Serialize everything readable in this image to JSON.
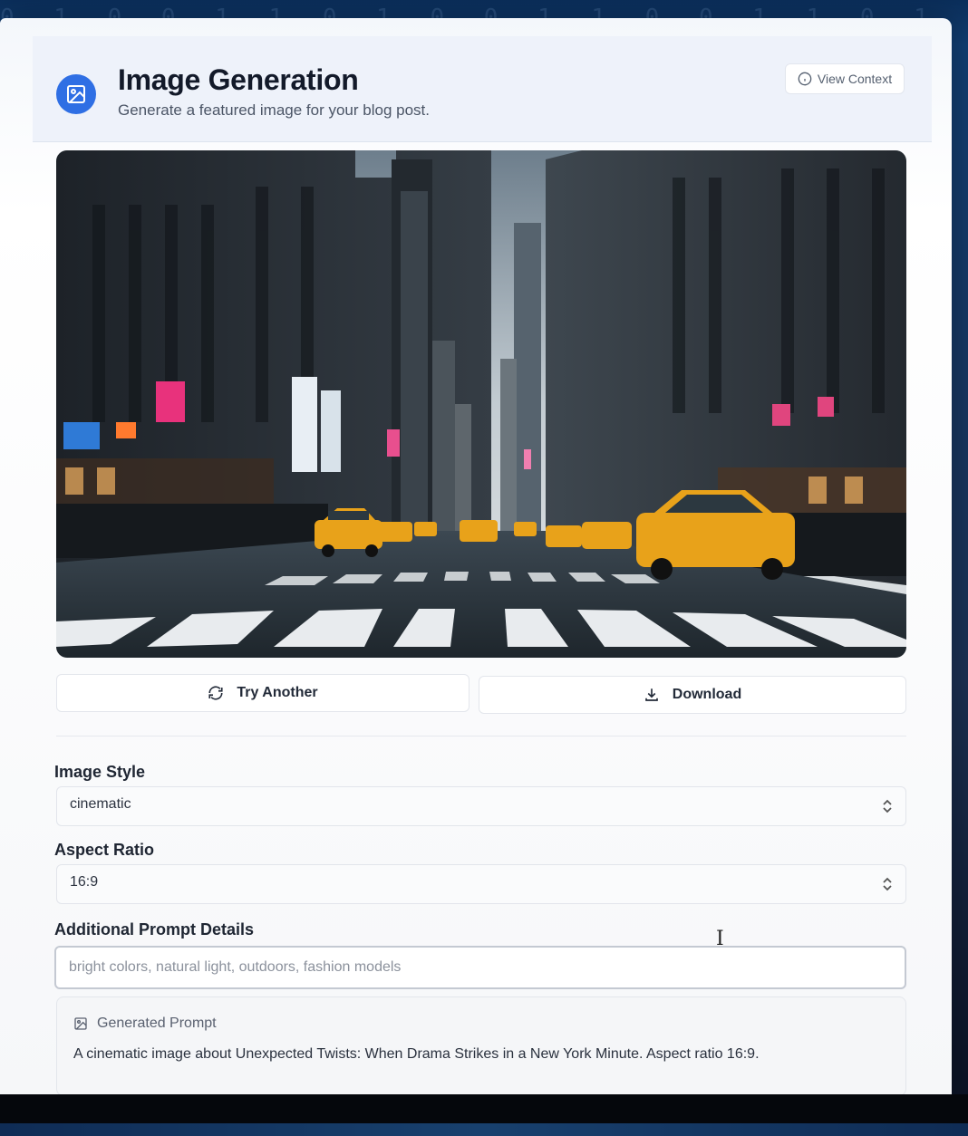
{
  "header": {
    "title": "Image Generation",
    "subtitle": "Generate a featured image for your blog post.",
    "view_context_label": "View Context",
    "app_icon": "image-icon",
    "view_context_icon": "info-icon"
  },
  "actions": {
    "try_another_label": "Try Another",
    "try_another_icon": "refresh-icon",
    "download_label": "Download",
    "download_icon": "download-icon"
  },
  "form": {
    "image_style": {
      "label": "Image Style",
      "value": "cinematic"
    },
    "aspect_ratio": {
      "label": "Aspect Ratio",
      "value": "16:9"
    },
    "prompt_details": {
      "label": "Additional Prompt Details",
      "placeholder": "bright colors, natural light, outdoors, fashion models",
      "value": ""
    }
  },
  "generated_prompt": {
    "heading": "Generated Prompt",
    "text": "A cinematic image about Unexpected Twists: When Drama Strikes in a New York Minute. Aspect ratio 16:9."
  },
  "colors": {
    "accent": "#2f6fe4",
    "taxi": "#e8a21a"
  }
}
